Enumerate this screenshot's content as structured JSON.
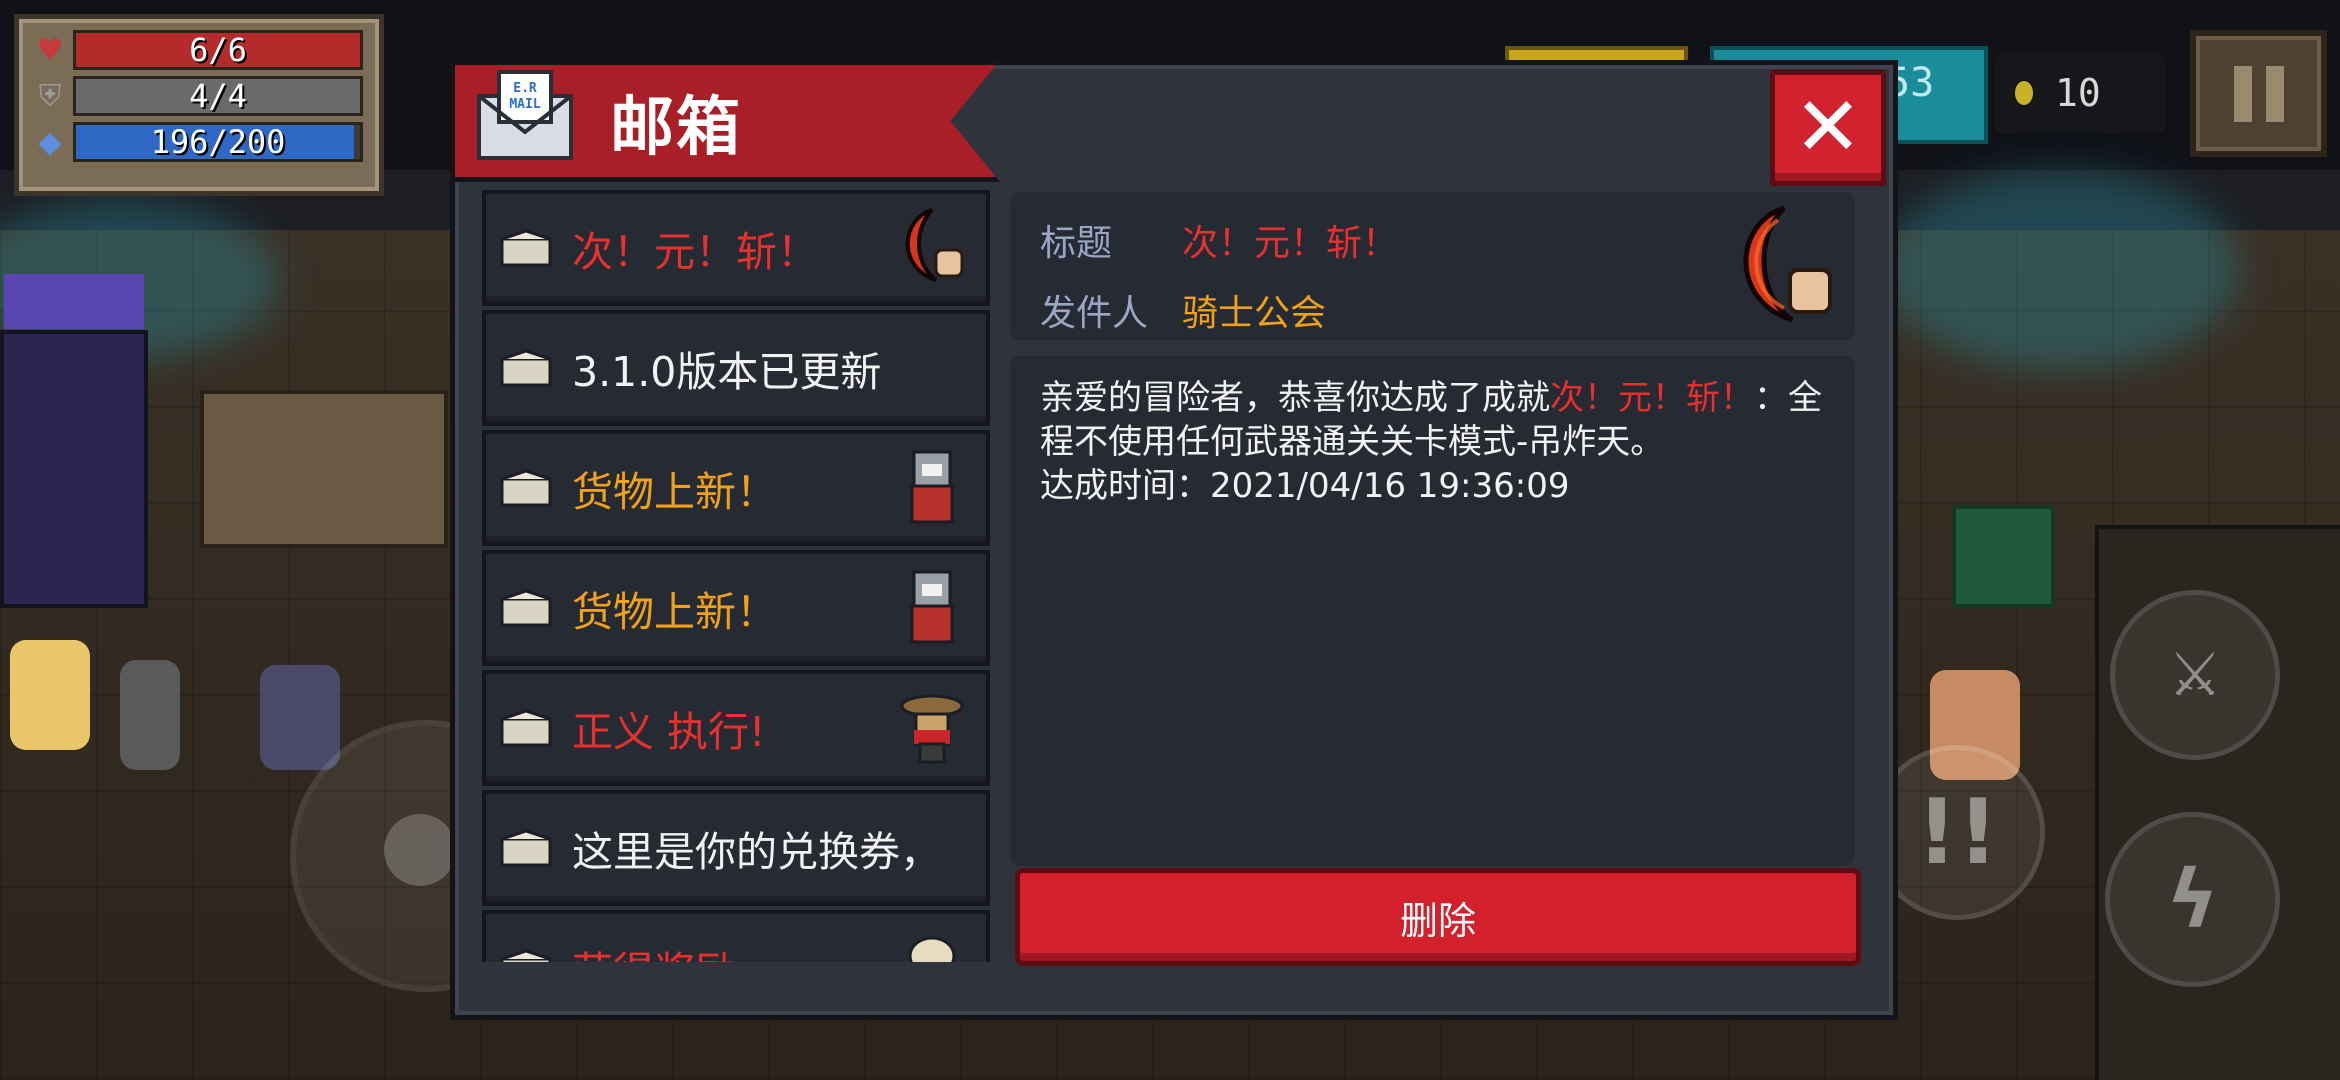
{
  "hud": {
    "health": "6/6",
    "armor": "4/4",
    "energy": "196/200",
    "gems_partial": "53",
    "coins": "10"
  },
  "mailbox": {
    "title": "邮箱",
    "close_symbol": "✕",
    "items": [
      {
        "label": "次！元！斩！",
        "color": "#e8302f",
        "thumb": "crescent-blade-icon"
      },
      {
        "label": "3.1.0版本已更新",
        "color": "#f2f2f2",
        "thumb": ""
      },
      {
        "label": "货物上新！",
        "color": "#f0a019",
        "thumb": "merchant-cat-icon"
      },
      {
        "label": "货物上新！",
        "color": "#f0a019",
        "thumb": "merchant-cat-icon"
      },
      {
        "label": "正义 执行!",
        "color": "#e8302f",
        "thumb": "cowboy-hat-icon"
      },
      {
        "label": "这里是你的兑换券，",
        "color": "#f2f2f2",
        "thumb": ""
      },
      {
        "label": "获得奖励",
        "color": "#e8302f",
        "thumb": "bird-icon"
      }
    ],
    "detail": {
      "title_key": "标题",
      "title_value": "次！元！斩！",
      "sender_key": "发件人",
      "sender_value": "骑士公会",
      "body_prefix": "亲爱的冒险者，恭喜你达成了成就",
      "body_achievement": "次！元！斩！",
      "body_suffix": "：全程不使用任何武器通关关卡模式-吊炸天。",
      "body_time": "达成时间：2021/04/16 19:36:09"
    },
    "delete_label": "删除"
  },
  "colors": {
    "accent_red": "#d41f2d",
    "title_red": "#e8302f",
    "title_orange": "#f0a019",
    "sender_gold": "#f0a019",
    "panel": "#2f333c"
  }
}
